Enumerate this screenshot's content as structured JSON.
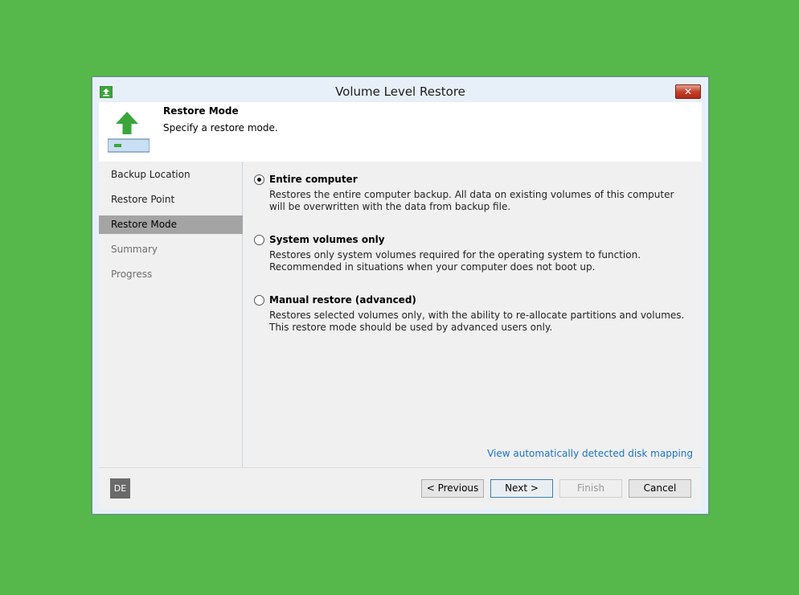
{
  "window": {
    "title": "Volume Level Restore",
    "close_label": "✕"
  },
  "header": {
    "title": "Restore Mode",
    "subtitle": "Specify a restore mode."
  },
  "nav": {
    "items": [
      {
        "label": "Backup Location",
        "state": "done"
      },
      {
        "label": "Restore Point",
        "state": "done"
      },
      {
        "label": "Restore Mode",
        "state": "active"
      },
      {
        "label": "Summary",
        "state": "disabled"
      },
      {
        "label": "Progress",
        "state": "disabled"
      }
    ]
  },
  "options": [
    {
      "label": "Entire computer",
      "description": "Restores the entire computer backup. All data on existing volumes of this computer will be overwritten with the data from backup file.",
      "checked": true
    },
    {
      "label": "System volumes only",
      "description": "Restores only system volumes required for the operating system to function. Recommended in situations when your computer does not boot up.",
      "checked": false
    },
    {
      "label": "Manual restore (advanced)",
      "description": "Restores selected volumes only, with the ability to re-allocate partitions and volumes. This restore mode should be used by advanced users only.",
      "checked": false
    }
  ],
  "link": {
    "label": "View automatically detected disk mapping"
  },
  "footer": {
    "language_badge": "DE",
    "previous_label": "< Previous",
    "next_label": "Next >",
    "finish_label": "Finish",
    "cancel_label": "Cancel"
  },
  "colors": {
    "background": "#56b84b",
    "accent_green": "#3aa63a",
    "link": "#1a73c8",
    "nav_active": "#a4a4a4"
  },
  "icons": {
    "app": "upload-arrow-icon",
    "header": "restore-arrow-icon"
  }
}
